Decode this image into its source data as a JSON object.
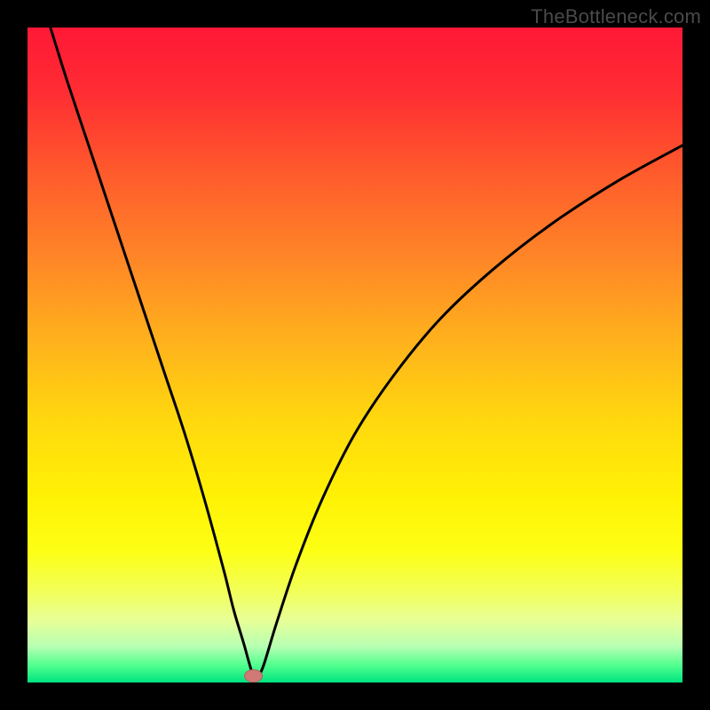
{
  "watermark": "TheBottleneck.com",
  "colors": {
    "frame": "#000000",
    "curve": "#000000",
    "marker_fill": "#cf7a77",
    "marker_stroke": "#b16360",
    "gradient_stops": [
      {
        "offset": 0.0,
        "color": "#ff1836"
      },
      {
        "offset": 0.1,
        "color": "#ff2d33"
      },
      {
        "offset": 0.22,
        "color": "#ff5a2c"
      },
      {
        "offset": 0.35,
        "color": "#ff8527"
      },
      {
        "offset": 0.48,
        "color": "#ffb21c"
      },
      {
        "offset": 0.6,
        "color": "#ffd80e"
      },
      {
        "offset": 0.72,
        "color": "#fff205"
      },
      {
        "offset": 0.8,
        "color": "#fdff15"
      },
      {
        "offset": 0.86,
        "color": "#f2ff58"
      },
      {
        "offset": 0.905,
        "color": "#e8ff97"
      },
      {
        "offset": 0.945,
        "color": "#b7ffb2"
      },
      {
        "offset": 0.975,
        "color": "#4dff8d"
      },
      {
        "offset": 1.0,
        "color": "#00e381"
      }
    ]
  },
  "chart_data": {
    "type": "line",
    "title": "",
    "xlabel": "",
    "ylabel": "",
    "xlim": [
      0,
      100
    ],
    "ylim": [
      0,
      100
    ],
    "series": [
      {
        "name": "bottleneck-curve",
        "x": [
          3.5,
          6,
          9,
          12,
          15,
          18,
          21,
          24,
          27,
          30,
          31.5,
          33,
          34.3,
          35,
          36,
          38,
          41,
          45,
          50,
          56,
          63,
          71,
          80,
          90,
          100
        ],
        "y": [
          100,
          92,
          83,
          74,
          65,
          56,
          47,
          38,
          28,
          17,
          11,
          6,
          1.5,
          0.8,
          2.5,
          9,
          18,
          28,
          38,
          47,
          55.5,
          63,
          70,
          76.5,
          82
        ]
      }
    ],
    "annotations": [
      {
        "name": "optimum-marker",
        "x": 34.5,
        "y": 1.0
      }
    ]
  }
}
